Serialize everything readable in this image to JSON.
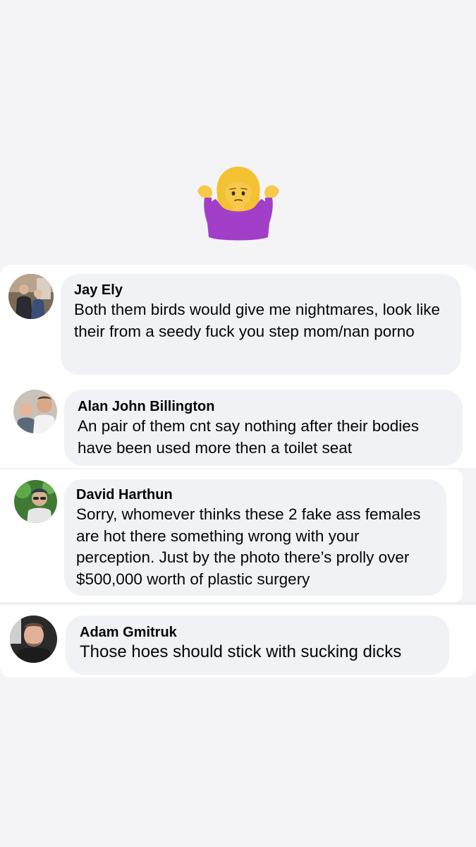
{
  "reaction": {
    "emoji": "person-shrugging-icon"
  },
  "comments": [
    {
      "author": "Jay Ely",
      "text": "Both them birds would give me nightmares, look like their from a seedy fuck you step mom/nan porno"
    },
    {
      "author": "Alan John Billington",
      "text": "An pair of them cnt say nothing after their bodies have been used more then a toilet seat"
    },
    {
      "author": "David Harthun",
      "text": "Sorry, whomever thinks these 2 fake ass females are hot there something wrong with your perception. Just by the photo there’s prolly over $500,000 worth of plastic surgery"
    },
    {
      "author": "Adam Gmitruk",
      "text": "Those hoes should stick with sucking dicks"
    }
  ],
  "colors": {
    "page_background": "#f4f4f6",
    "card_background": "#ffffff",
    "bubble_background": "#f0f2f5",
    "text": "#050505",
    "emoji_hair": "#f2c233",
    "emoji_skin": "#f7c94b",
    "emoji_shirt": "#a23fc9"
  }
}
